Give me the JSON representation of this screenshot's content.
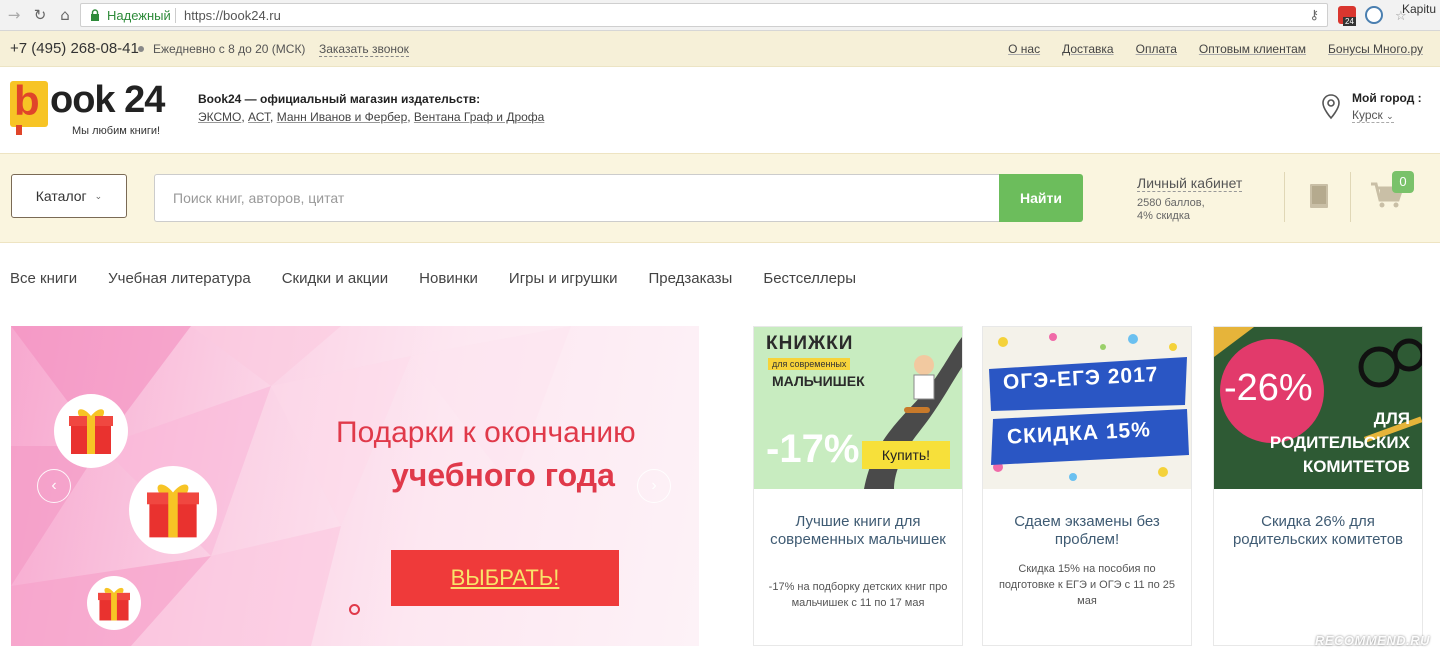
{
  "browser": {
    "secure_label": "Надежный",
    "url": "https://book24.ru",
    "profile": "Kapitu",
    "ext_badge": "24"
  },
  "topbar": {
    "phone": "+7 (495) 268-08-41",
    "hours": "Ежедневно с 8 до 20 (МСК)",
    "callback": "Заказать звонок",
    "links": [
      "О нас",
      "Доставка",
      "Оплата",
      "Оптовым клиентам",
      "Бонусы Много.ру"
    ]
  },
  "header": {
    "logo_b": "b",
    "logo_rest": "ook 24",
    "slogan": "Мы любим книги!",
    "official": "Book24 — официальный магазин издательств:",
    "publishers": [
      "ЭКСМО",
      "АСТ",
      "Манн Иванов и Фербер",
      "Вентана Граф и Дрофа"
    ],
    "city_label": "Мой город :",
    "city_value": "Курск"
  },
  "search": {
    "catalog_label": "Каталог",
    "placeholder": "Поиск книг, авторов, цитат",
    "button_label": "Найти",
    "cabinet_label": "Личный кабинет",
    "points": "2580 баллов,",
    "discount": "4% скидка",
    "cart_count": "0"
  },
  "menu": [
    "Все книги",
    "Учебная литература",
    "Скидки и акции",
    "Новинки",
    "Игры и игрушки",
    "Предзаказы",
    "Бестселлеры"
  ],
  "banner": {
    "title_line1": "Подарки к окончанию",
    "title_line2": "учебного года",
    "cta": "ВЫБРАТЬ!",
    "prev": "‹",
    "next": "›"
  },
  "cards": [
    {
      "img_line1": "КНИЖКИ",
      "img_line2": "для современных",
      "img_line3": "МАЛЬЧИШЕК",
      "img_discount": "-17%",
      "img_buy": "Купить!",
      "title": "Лучшие книги для современных мальчишек",
      "desc": "-17% на подборку детских книг про мальчишек с 11 по 17 мая"
    },
    {
      "img_line1": "ОГЭ-ЕГЭ 2017",
      "img_line2": "СКИДКА 15%",
      "title": "Сдаем экзамены без проблем!",
      "desc": "Скидка 15% на пособия по подготовке к ЕГЭ и ОГЭ с 11 по 25 мая"
    },
    {
      "img_discount": "-26%",
      "img_line1": "ДЛЯ",
      "img_line2": "РОДИТЕЛЬСКИХ",
      "img_line3": "КОМИТЕТОВ",
      "title": "Скидка 26% для родительских комитетов",
      "desc": ""
    }
  ],
  "watermark": "RECOMMEND.RU",
  "colors": {
    "brand_yellow": "#f7c425",
    "brand_red": "#e0452a",
    "search_green": "#6cbd5c",
    "banner_red": "#e0394a",
    "cta_red": "#ef3a3a"
  }
}
